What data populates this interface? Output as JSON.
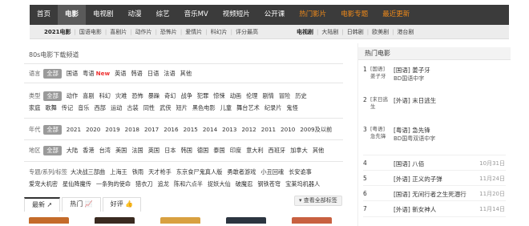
{
  "nav": {
    "items": [
      "首页",
      "电影",
      "电视剧",
      "动漫",
      "综艺",
      "音乐MV",
      "视频短片",
      "公开课",
      "热门影片",
      "电影专题",
      "最近更新"
    ]
  },
  "subnav": {
    "left": [
      "2021电影",
      "国语电影",
      "喜剧片",
      "动作片",
      "恐怖片",
      "爱情片",
      "科幻片",
      "评分最高"
    ],
    "right": [
      "电视剧",
      "大陆剧",
      "日韩剧",
      "欧美剧",
      "港台剧"
    ]
  },
  "main": {
    "title": "80s电影下载频道",
    "filters": {
      "lang": {
        "label": "语言",
        "values": [
          "全部",
          "国语",
          "粤语",
          "New",
          "英语",
          "韩语",
          "日语",
          "法语",
          "其他"
        ]
      },
      "type": {
        "label": "类型",
        "values": [
          "全部",
          "动作",
          "喜剧",
          "科幻",
          "灾难",
          "恐怖",
          "暴躁",
          "奇幻",
          "战争",
          "犯罪",
          "惊悚",
          "动画",
          "伦理",
          "剧情",
          "冒险",
          "历史"
        ]
      },
      "type2": {
        "values": [
          "家庭",
          "歌舞",
          "传记",
          "音乐",
          "西部",
          "运动",
          "古装",
          "同性",
          "武侠",
          "短片",
          "黑色电影",
          "儿童",
          "舞台艺术",
          "纪录片",
          "鬼怪"
        ]
      },
      "year": {
        "label": "年代",
        "values": [
          "全部",
          "2021",
          "2020",
          "2019",
          "2018",
          "2017",
          "2016",
          "2015",
          "2014",
          "2013",
          "2012",
          "2011",
          "2010",
          "2009及以前"
        ]
      },
      "region": {
        "label": "地区",
        "values": [
          "全部",
          "大陆",
          "香港",
          "台湾",
          "美国",
          "法国",
          "英国",
          "日本",
          "韩国",
          "德国",
          "泰国",
          "印度",
          "意大利",
          "西班牙",
          "加拿大",
          "其他"
        ]
      },
      "topics": {
        "label": "专题/系列/标签",
        "values": [
          "大决战三部曲",
          "上海王",
          "铁雨",
          "天才枪手",
          "东京食尸鬼真人版",
          "勇敢者游戏",
          "小丑回魂",
          "长安诡事"
        ]
      },
      "topics2": {
        "values": [
          "爱宠大机密",
          "星仙降魔传",
          "一条狗的使命",
          "猎衣刀",
          "追龙",
          "陈和六点半",
          "捉妖大仙",
          "破魔忍",
          "钢铁苍穹",
          "宝莱坞机器人"
        ]
      }
    },
    "more_tags": "查看全部标签",
    "tabs": [
      "最新",
      "热门",
      "好评"
    ]
  },
  "sidebar": {
    "title": "热门电影",
    "top": [
      {
        "rank": "1",
        "img_alt": "[国语]姜子牙",
        "title": "[国语] 姜子牙",
        "desc": "BD国语中字"
      },
      {
        "rank": "2",
        "img_alt": "[末日逃生",
        "title": "[外语] 末日逃生",
        "desc": ""
      },
      {
        "rank": "3",
        "img_alt": "[粤语]急先锋",
        "title": "[粤语] 急先锋",
        "desc": "BD国粤双语中字"
      }
    ],
    "list": [
      {
        "rank": "4",
        "title": "[国语] 八佰",
        "date": "10月31日"
      },
      {
        "rank": "5",
        "title": "[外语] 正义的子弹",
        "date": "11月24日"
      },
      {
        "rank": "6",
        "title": "[国语] 无间行者之生死潜行",
        "date": "11月20日"
      },
      {
        "rank": "7",
        "title": "[外语] 新女神人",
        "date": "11月14日"
      }
    ]
  },
  "colors": {
    "nav_bg": "#3b3b3b",
    "accent": "#f08a19",
    "new": "#e33333"
  }
}
